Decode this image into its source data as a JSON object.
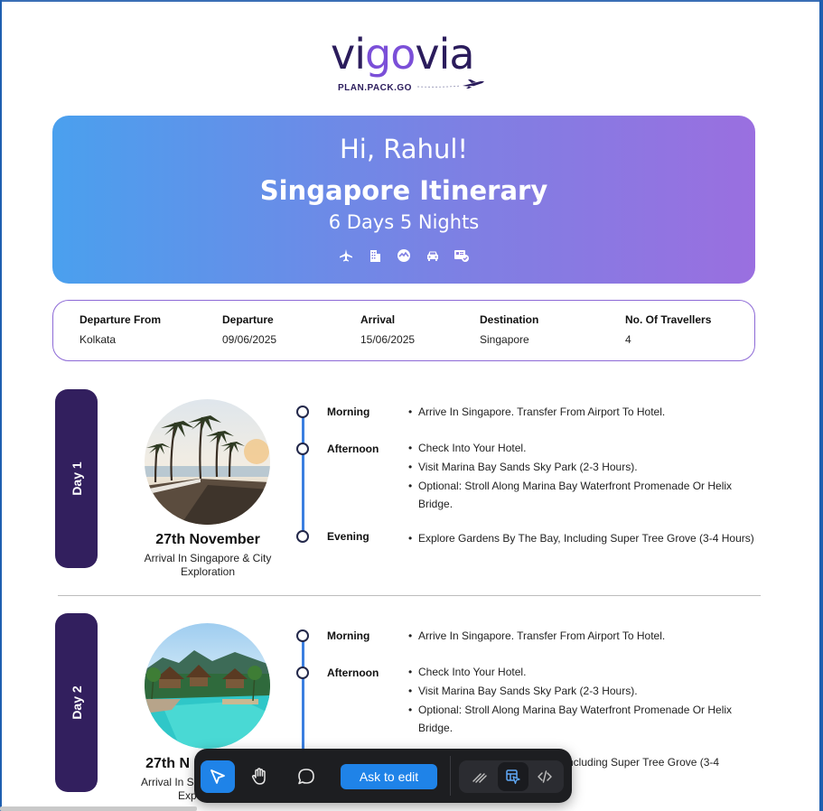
{
  "brand": {
    "name_part1": "vi",
    "name_part2": "go",
    "name_part3": "via",
    "tagline": "PLAN.PACK.GO"
  },
  "hero": {
    "greeting": "Hi, Rahul!",
    "title": "Singapore Itinerary",
    "subtitle": "6 Days 5 Nights",
    "icons": [
      "flight-icon",
      "hotel-icon",
      "sightseeing-icon",
      "taxi-icon",
      "visa-icon"
    ]
  },
  "summary": {
    "departure_from_label": "Departure From",
    "departure_from_value": "Kolkata",
    "departure_label": "Departure",
    "departure_value": "09/06/2025",
    "arrival_label": "Arrival",
    "arrival_value": "15/06/2025",
    "destination_label": "Destination",
    "destination_value": "Singapore",
    "travellers_label": "No. Of Travellers",
    "travellers_value": "4"
  },
  "days": [
    {
      "label": "Day 1",
      "date": "27th November",
      "description": "Arrival In Singapore & City Exploration",
      "morning_label": "Morning",
      "morning": [
        "Arrive In Singapore. Transfer From Airport To Hotel."
      ],
      "afternoon_label": "Afternoon",
      "afternoon": [
        "Check Into Your Hotel.",
        "Visit Marina Bay Sands Sky Park (2-3 Hours).",
        "Optional: Stroll Along Marina Bay Waterfront Promenade Or Helix Bridge."
      ],
      "evening_label": "Evening",
      "evening": [
        "Explore Gardens By The Bay, Including Super Tree Grove (3-4 Hours)"
      ]
    },
    {
      "label": "Day 2",
      "date": "27th N",
      "description_line1": "Arrival In S",
      "description_line2": "Exp",
      "morning_label": "Morning",
      "morning": [
        "Arrive In Singapore. Transfer From Airport To Hotel."
      ],
      "afternoon_label": "Afternoon",
      "afternoon": [
        "Check Into Your Hotel.",
        "Visit Marina Bay Sands Sky Park (2-3 Hours).",
        "Optional: Stroll Along Marina Bay Waterfront Promenade Or Helix Bridge."
      ],
      "evening_partial": "ncluding Super Tree Grove (3-4"
    }
  ],
  "toolbar": {
    "ask_label": "Ask to edit",
    "tools": [
      "select-cursor-icon",
      "hand-pan-icon",
      "comment-icon",
      "draw-icon",
      "inspect-icon",
      "code-icon"
    ]
  },
  "colors": {
    "accent": "#1f83e8",
    "brand_dark": "#2b1c5c",
    "brand_purple": "#7b4fd8",
    "day_tab": "#321f5e",
    "timeline": "#3b7fe0"
  }
}
